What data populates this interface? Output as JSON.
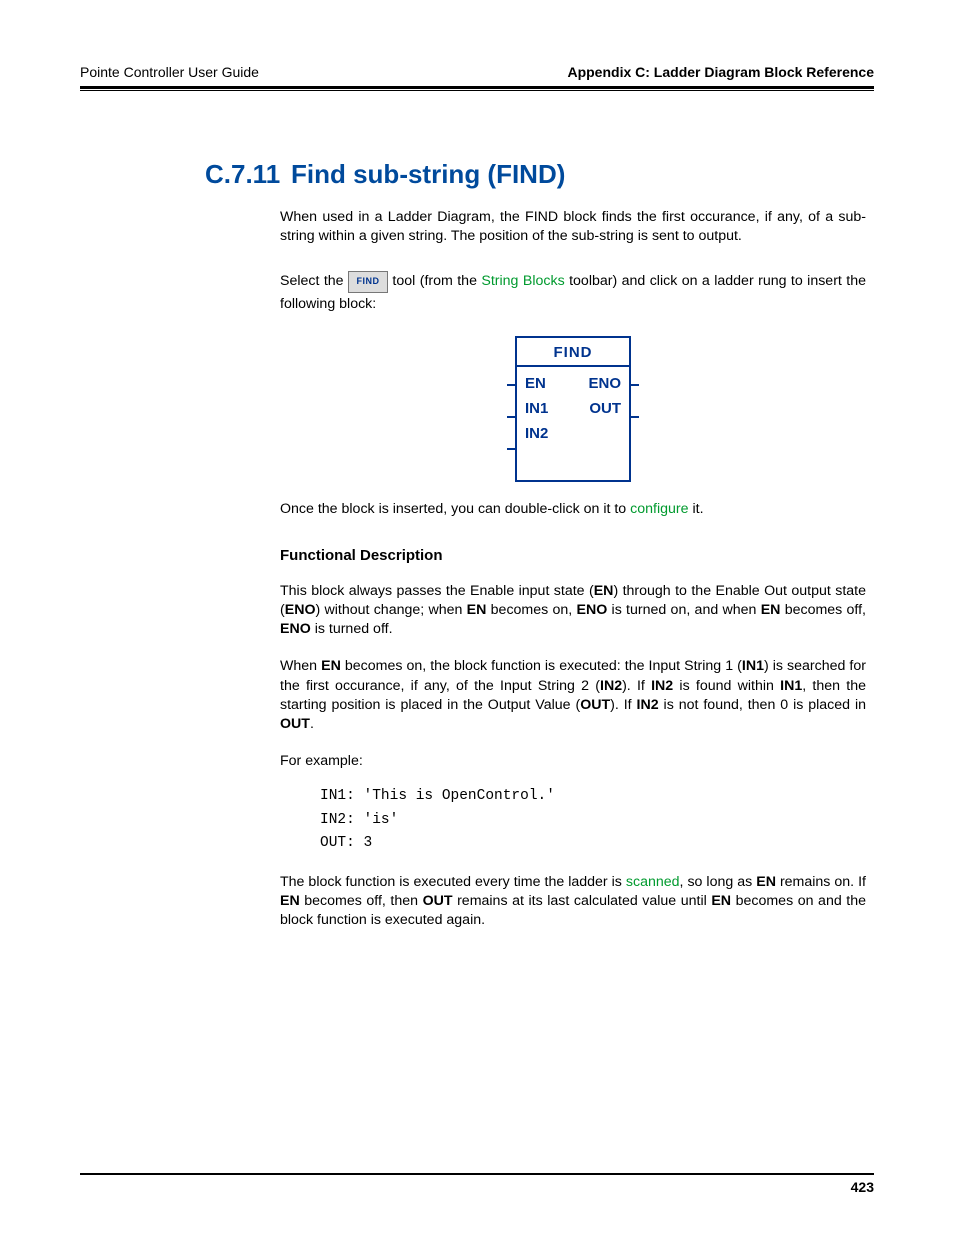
{
  "header": {
    "left": "Pointe Controller User Guide",
    "right": "Appendix C: Ladder Diagram Block Reference"
  },
  "section": {
    "number": "C.7.11",
    "title": "Find sub-string (FIND)"
  },
  "body": {
    "intro": "When used in a Ladder Diagram, the FIND block finds the first occurance, if any, of a sub-string within a given string. The position of the sub-string is sent to output.",
    "tool_pre": "Select the ",
    "tool_btn_label": "FIND",
    "tool_mid": " tool (from the ",
    "tool_link": "String Blocks",
    "tool_post": " toolbar) and click on a ladder rung to insert the following block:",
    "after_diag_pre": "Once the block is inserted, you can double-click on it to ",
    "after_diag_link": "configure",
    "after_diag_post": " it.",
    "func_heading": "Functional Description",
    "func_p1_a": "This block always passes the Enable input state (",
    "func_p1_en": "EN",
    "func_p1_b": ") through to the Enable Out output state (",
    "func_p1_eno": "ENO",
    "func_p1_c": ") without change; when ",
    "func_p1_d": " becomes on, ",
    "func_p1_e": " is turned on, and when ",
    "func_p1_f": " becomes off, ",
    "func_p1_g": " is turned off.",
    "func_p2_a": "When ",
    "func_p2_b": " becomes on, the block function is executed: the Input String 1 (",
    "func_p2_in1": "IN1",
    "func_p2_c": ") is searched for the first occurance, if any, of the Input String 2 (",
    "func_p2_in2": "IN2",
    "func_p2_d": "). If ",
    "func_p2_e": " is found within ",
    "func_p2_f": ", then the starting position is placed in the Output Value (",
    "func_p2_out": "OUT",
    "func_p2_g": "). If ",
    "func_p2_h": " is not found, then 0 is placed in ",
    "func_p2_i": ".",
    "example_label": "For example:",
    "code": "IN1: 'This is OpenControl.'\nIN2: 'is'\nOUT: 3",
    "closing_a": "The block function is executed every time the ladder is ",
    "closing_link": "scanned",
    "closing_b": ", so long as ",
    "closing_c": " remains on. If ",
    "closing_d": " becomes off, then ",
    "closing_e": " remains at its last calculated value until ",
    "closing_f": " becomes on and the block function is executed again."
  },
  "diagram": {
    "title": "FIND",
    "en": "EN",
    "eno": "ENO",
    "in1": "IN1",
    "out": "OUT",
    "in2": "IN2"
  },
  "footer": {
    "page": "423"
  }
}
